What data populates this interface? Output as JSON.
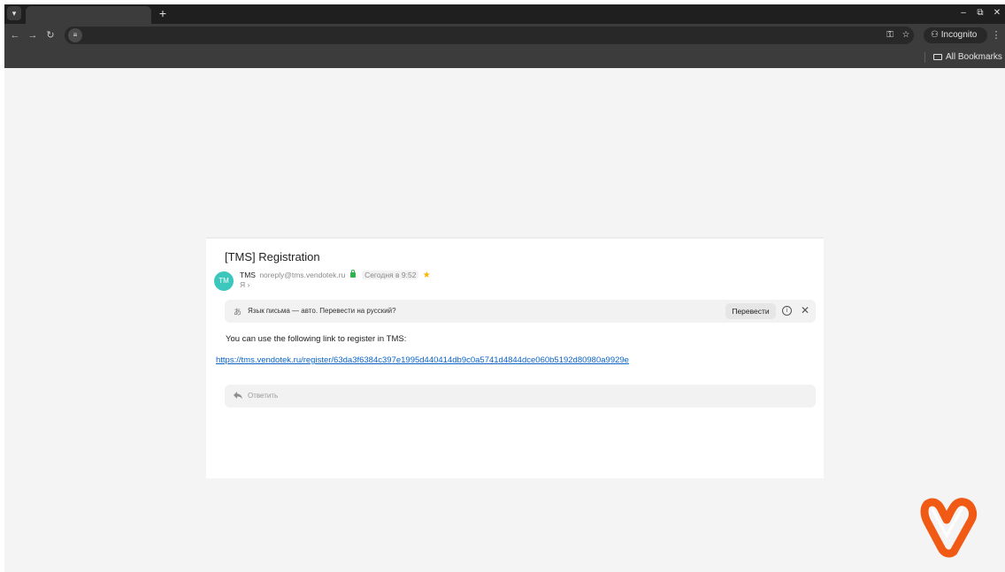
{
  "browser": {
    "tab_menu_icon": "chevron-down-icon",
    "new_tab_label": "+",
    "window_controls": {
      "minimize": "–",
      "restore": "⧉",
      "close": "✕"
    },
    "nav": {
      "back": "←",
      "forward": "→",
      "reload": "↻"
    },
    "incognito_label": "Incognito",
    "bookmarks": {
      "all_label": "All Bookmarks"
    }
  },
  "email": {
    "subject": "[TMS] Registration",
    "sender": {
      "avatar_initials": "TM",
      "name": "TMS",
      "email": "noreply@tms.vendotek.ru",
      "date": "Сегодня в 9:52",
      "recipient": "Я ›"
    },
    "translate": {
      "icon_glyph": "あ",
      "text": "Язык письма — авто. Перевести на русский?",
      "button_label": "Перевести",
      "info_glyph": "i",
      "close_glyph": "✕"
    },
    "body_text": "You can use the following link to register in TMS:",
    "link": "https://tms.vendotek.ru/register/63da3f6384c397e1995d440414db9c0a5741d4844dce060b5192d80980a9929e",
    "reply_label": "Ответить"
  },
  "colors": {
    "avatar": "#3cc7bc",
    "link": "#0a64c8",
    "star": "#f7b500",
    "brand": "#f05a14"
  }
}
